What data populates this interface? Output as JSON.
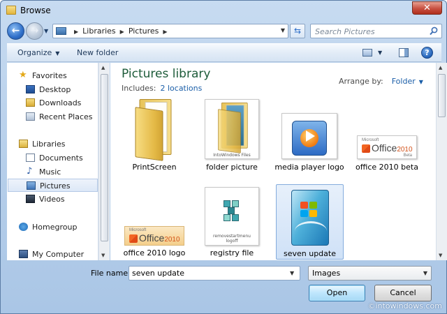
{
  "window": {
    "title": "Browse"
  },
  "address": {
    "crumbs": [
      "Libraries",
      "Pictures"
    ],
    "search_placeholder": "Search Pictures"
  },
  "toolbar": {
    "organize": "Organize",
    "new_folder": "New folder"
  },
  "nav": {
    "favorites": "Favorites",
    "desktop": "Desktop",
    "downloads": "Downloads",
    "recent": "Recent Places",
    "libraries": "Libraries",
    "documents": "Documents",
    "music": "Music",
    "pictures": "Pictures",
    "videos": "Videos",
    "homegroup": "Homegroup",
    "computer": "My Computer",
    "selected": "Pictures"
  },
  "library": {
    "title": "Pictures library",
    "includes_label": "Includes:",
    "includes_link": "2 locations",
    "arrange_label": "Arrange by:",
    "arrange_value": "Folder"
  },
  "items": [
    {
      "name": "PrintScreen",
      "kind": "folder"
    },
    {
      "name": "folder picture",
      "kind": "folder-image",
      "caption": "IntoWindows Files"
    },
    {
      "name": "media player logo",
      "kind": "image"
    },
    {
      "name": "office 2010 beta",
      "kind": "image",
      "logo": {
        "brand": "Microsoft",
        "product": "Office",
        "year": "2010",
        "tag": "Beta"
      }
    },
    {
      "name": "office 2010 logo",
      "kind": "image",
      "logo": {
        "brand": "Microsoft",
        "product": "Office",
        "year": "2010"
      }
    },
    {
      "name": "registry file",
      "kind": "file",
      "caption": "removestartmenu logoff"
    },
    {
      "name": "seven update",
      "kind": "image",
      "selected": true
    }
  ],
  "form": {
    "file_name_label": "File name:",
    "file_name_value": "seven update",
    "file_type_value": "Images",
    "open_label": "Open",
    "cancel_label": "Cancel"
  },
  "watermark": "©intowindows.com",
  "colors": {
    "title_green": "#1e5c3a",
    "link_blue": "#1a5ea8",
    "selection_blue": "#cfe1f7",
    "close_red": "#c75041"
  },
  "icons": {
    "back": "arrow-left-icon",
    "forward": "arrow-right-icon",
    "refresh": "refresh-icon",
    "search": "search-icon",
    "help": "help-icon"
  }
}
